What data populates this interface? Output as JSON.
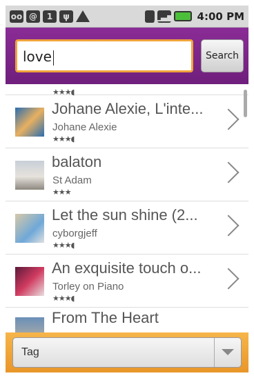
{
  "status_bar": {
    "time": "4:00 PM",
    "icons": [
      "voicemail-icon",
      "at-sign-icon",
      "calendar-icon",
      "usb-icon",
      "warning-icon",
      "sim-icon",
      "signal-icon",
      "battery-icon"
    ],
    "calendar_day": "1"
  },
  "search": {
    "value": "love",
    "button_label": "Search"
  },
  "results": [
    {
      "title": "Johane Alexie, L'inte...",
      "author": "Johane Alexie",
      "rating": 3.5
    },
    {
      "title": "balaton",
      "author": "St Adam",
      "rating": 3
    },
    {
      "title": "Let the sun shine (2...",
      "author": "cyborgjeff",
      "rating": 3.5
    },
    {
      "title": "An exquisite touch o...",
      "author": "Torley on Piano",
      "rating": 3.5
    },
    {
      "title": "From The Heart",
      "author": "",
      "rating": null
    }
  ],
  "filter": {
    "selected": "Tag"
  },
  "colors": {
    "header": "#7a2488",
    "accent": "#f0a43a"
  }
}
